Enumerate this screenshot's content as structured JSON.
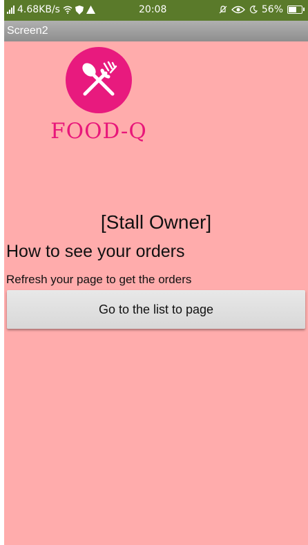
{
  "status_bar": {
    "speed": "4.68KB/s",
    "time": "20:08",
    "battery": "56%"
  },
  "title_bar": {
    "title": "Screen2"
  },
  "logo": {
    "text": "FOOD-Q",
    "color": "#e81a7e"
  },
  "main": {
    "role_label": "[Stall Owner]",
    "heading": "How to see your orders",
    "instruction": "Refresh your page to get the orders",
    "button_label": "Go to the list to page"
  },
  "colors": {
    "background": "#ffacac",
    "status_bar": "#5a7a2a",
    "title_bar": "#9e9e9e",
    "button": "#e0e0e0"
  }
}
